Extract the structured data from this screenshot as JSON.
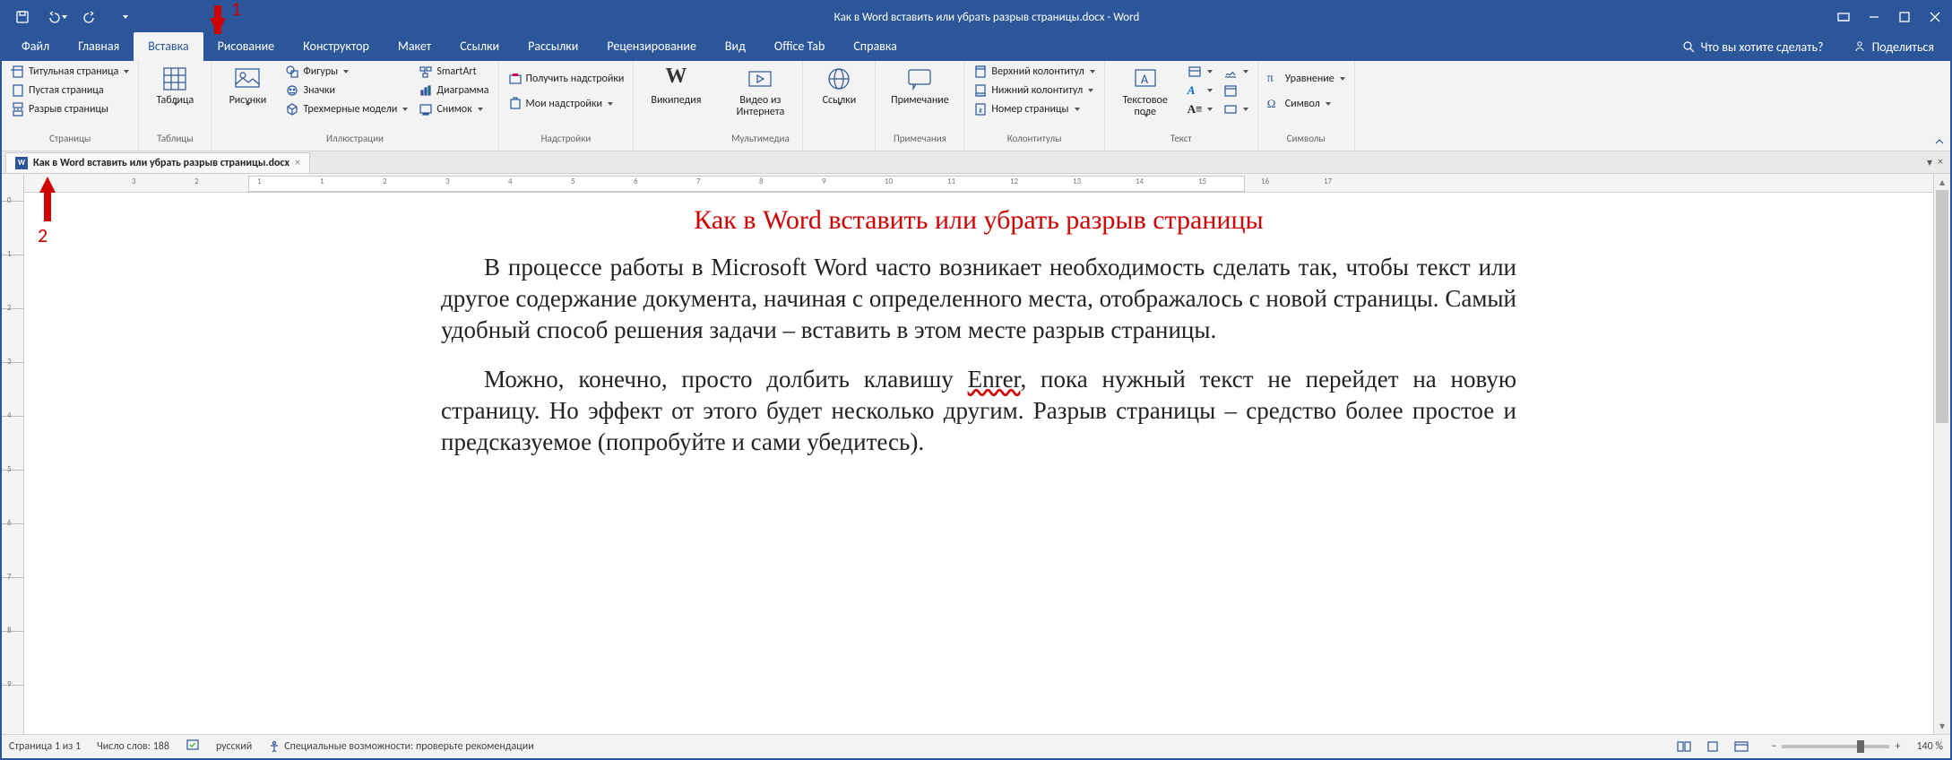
{
  "title": "Как в Word вставить или убрать разрыв страницы.docx  -  Word",
  "tabs": {
    "file": "Файл",
    "home": "Главная",
    "insert": "Вставка",
    "draw": "Рисование",
    "design": "Конструктор",
    "layout": "Макет",
    "references": "Ссылки",
    "mailings": "Рассылки",
    "review": "Рецензирование",
    "view": "Вид",
    "officetab": "Office Tab",
    "help": "Справка"
  },
  "tellme": "Что вы хотите сделать?",
  "share": "Поделиться",
  "ribbon": {
    "pages": {
      "cover": "Титульная страница",
      "blank": "Пустая страница",
      "break": "Разрыв страницы",
      "label": "Страницы"
    },
    "tables": {
      "table": "Таблица",
      "label": "Таблицы"
    },
    "illustrations": {
      "pictures": "Рисунки",
      "shapes": "Фигуры",
      "icons": "Значки",
      "models3d": "Трехмерные модели",
      "smartart": "SmartArt",
      "chart": "Диаграмма",
      "screenshot": "Снимок",
      "label": "Иллюстрации"
    },
    "addins": {
      "get": "Получить надстройки",
      "my": "Мои надстройки",
      "label": "Надстройки"
    },
    "media_wiki": "Википедия",
    "media_video": "Видео из Интернета",
    "media_label": "Мультимедиа",
    "links": {
      "links": "Ссылки",
      "label": ""
    },
    "comments": {
      "comment": "Примечание",
      "label": "Примечания"
    },
    "headerfooter": {
      "header": "Верхний колонтитул",
      "footer": "Нижний колонтитул",
      "pagenum": "Номер страницы",
      "label": "Колонтитулы"
    },
    "text": {
      "textbox": "Текстовое поле",
      "label": "Текст"
    },
    "symbols": {
      "equation": "Уравнение",
      "symbol": "Символ",
      "label": "Символы"
    }
  },
  "doctab": "Как в Word вставить или убрать разрыв страницы.docx",
  "document": {
    "heading": "Как в Word вставить или убрать разрыв страницы",
    "p1a": "В процессе работы в Microsoft Word часто возникает необходимость сделать так, чтобы текст или другое содержание документа, начиная с определенного места, отображалось с новой страницы. Самый удобный способ решения задачи – вставить в этом месте разрыв страницы.",
    "p2a": "Можно, конечно, просто долбить клавишу ",
    "p2_typo": "Enrer",
    "p2b": ", пока нужный текст не перейдет на новую страницу. Но эффект от этого будет несколько другим. Разрыв страницы – средство более простое и предсказуемое (попробуйте и сами убедитесь)."
  },
  "ruler_numbers": [
    "3",
    "2",
    "1",
    "1",
    "2",
    "3",
    "4",
    "5",
    "6",
    "7",
    "8",
    "9",
    "10",
    "11",
    "12",
    "13",
    "14",
    "15",
    "16",
    "17"
  ],
  "status": {
    "page": "Страница 1 из 1",
    "words": "Число слов: 188",
    "lang": "русский",
    "a11y": "Специальные возможности: проверьте рекомендации",
    "zoom": "140 %"
  },
  "annotations": {
    "one": "1",
    "two": "2"
  }
}
